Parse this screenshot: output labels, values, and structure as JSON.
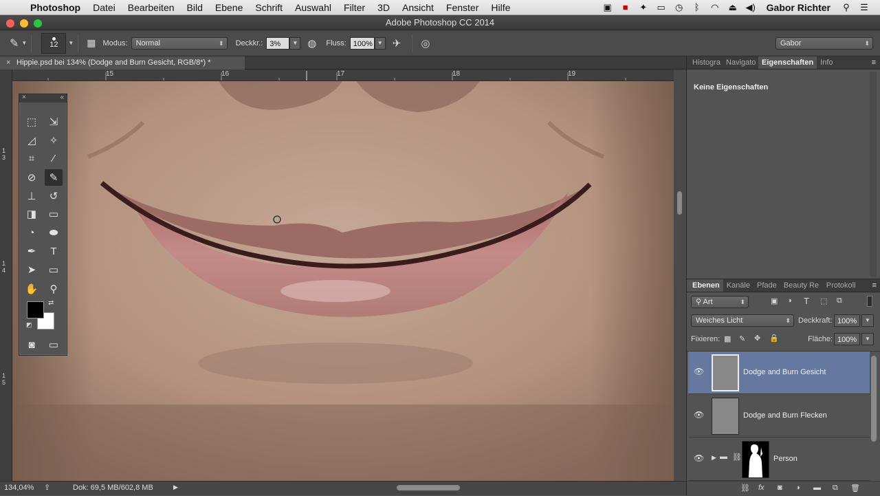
{
  "menubar": {
    "app": "Photoshop",
    "items": [
      "Datei",
      "Bearbeiten",
      "Bild",
      "Ebene",
      "Schrift",
      "Auswahl",
      "Filter",
      "3D",
      "Ansicht",
      "Fenster",
      "Hilfe"
    ],
    "user": "Gabor Richter"
  },
  "window": {
    "title": "Adobe Photoshop CC 2014"
  },
  "options": {
    "brush_size": "12",
    "modus_label": "Modus:",
    "modus_value": "Normal",
    "opacity_label": "Deckkr.:",
    "opacity_value": "3%",
    "flow_label": "Fluss:",
    "flow_value": "100%",
    "workspace": "Gabor"
  },
  "document": {
    "tab_title": "Hippie.psd bei 134% (Dodge and Burn Gesicht, RGB/8*) *",
    "ruler_h": [
      "15",
      "16",
      "17",
      "18",
      "19"
    ],
    "ruler_v": [
      [
        "1",
        "3"
      ],
      [
        "1",
        "4"
      ],
      [
        "1",
        "5"
      ]
    ]
  },
  "status": {
    "zoom": "134,04%",
    "doc": "Dok: 69,5 MB/602,8 MB"
  },
  "props_panel": {
    "tabs": [
      "Histogra",
      "Navigato",
      "Eigenschaften",
      "Info"
    ],
    "active_tab": "Eigenschaften",
    "content": "Keine Eigenschaften"
  },
  "layers_panel": {
    "tabs": [
      "Ebenen",
      "Kanäle",
      "Pfade",
      "Beauty Re",
      "Protokoll"
    ],
    "filter": "Art",
    "blend_mode": "Weiches Licht",
    "opacity_label": "Deckkraft:",
    "opacity_value": "100%",
    "lock_label": "Fixieren:",
    "fill_label": "Fläche:",
    "fill_value": "100%",
    "layers": [
      {
        "name": "Dodge and Burn Gesicht",
        "selected": true
      },
      {
        "name": "Dodge and Burn Flecken",
        "selected": false
      },
      {
        "name": "Person",
        "selected": false
      }
    ]
  },
  "colors": {
    "foreground": "#000000",
    "background": "#ffffff",
    "selection": "#6478a0"
  }
}
